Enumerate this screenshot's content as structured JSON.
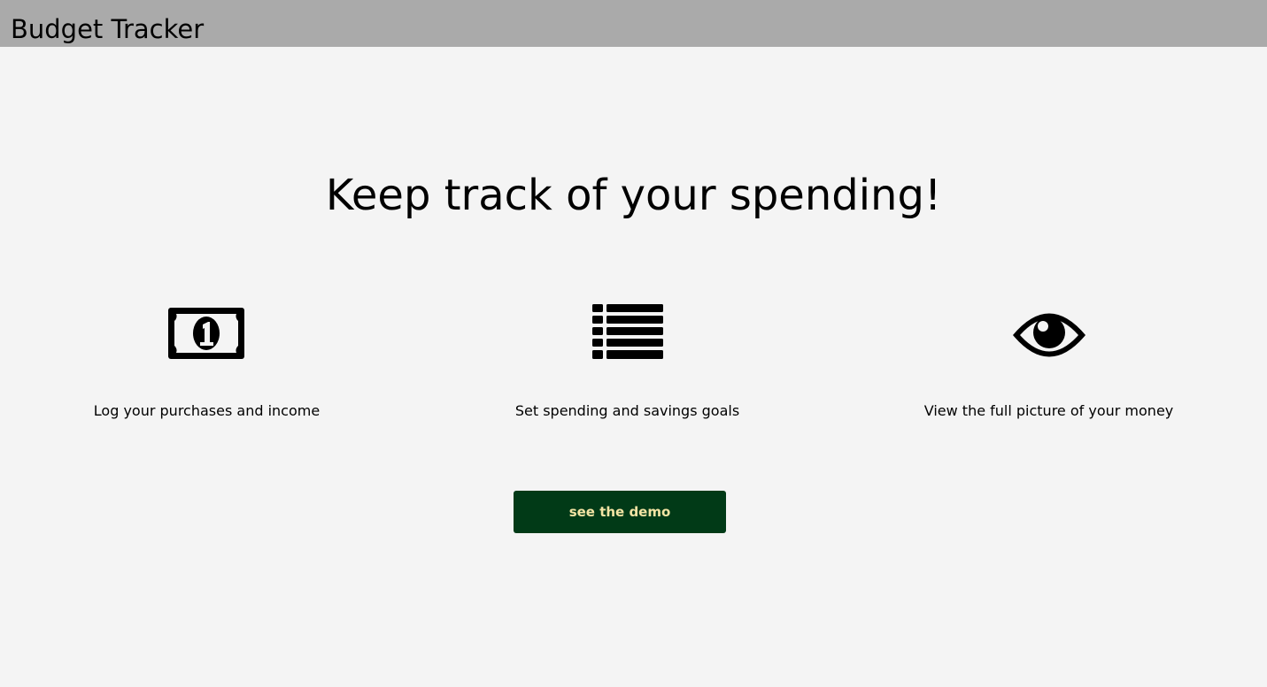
{
  "header": {
    "app_title": "Budget Tracker",
    "background_color": "#aaaaaa"
  },
  "main": {
    "headline": "Keep track of your spending!",
    "features": [
      {
        "icon": "money-bill-icon",
        "label": "Log your purchases and income"
      },
      {
        "icon": "list-icon",
        "label": "Set spending and savings goals"
      },
      {
        "icon": "eye-icon",
        "label": "View the full picture of your money"
      }
    ],
    "demo_button": {
      "label": "see the demo",
      "background_color": "#013a17",
      "text_color": "#f3e4a4"
    }
  },
  "page_background": "#f4f4f4"
}
